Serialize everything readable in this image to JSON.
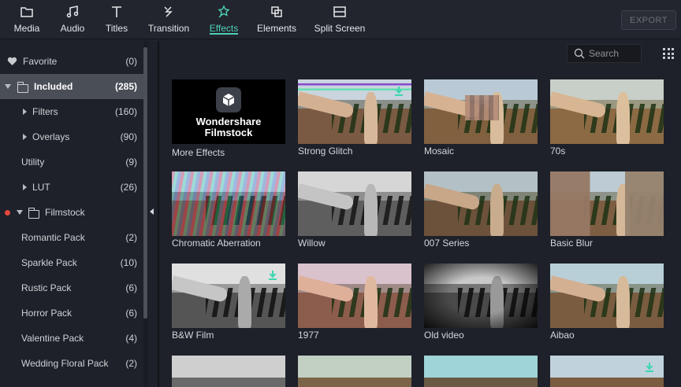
{
  "toolbar": {
    "tabs": [
      {
        "label": "Media",
        "icon": "folder-icon"
      },
      {
        "label": "Audio",
        "icon": "music-note-icon"
      },
      {
        "label": "Titles",
        "icon": "text-icon"
      },
      {
        "label": "Transition",
        "icon": "transition-icon"
      },
      {
        "label": "Effects",
        "icon": "effects-icon",
        "active": true
      },
      {
        "label": "Elements",
        "icon": "elements-icon"
      },
      {
        "label": "Split Screen",
        "icon": "split-screen-icon"
      }
    ],
    "export_label": "EXPORT",
    "accent_color": "#4dd0b8"
  },
  "sidebar": {
    "items": [
      {
        "label": "Favorite",
        "count": "(0)"
      },
      {
        "label": "Included",
        "count": "(285)"
      },
      {
        "label": "Filters",
        "count": "(160)"
      },
      {
        "label": "Overlays",
        "count": "(90)"
      },
      {
        "label": "Utility",
        "count": "(9)"
      },
      {
        "label": "LUT",
        "count": "(26)"
      },
      {
        "label": "Filmstock",
        "count": ""
      },
      {
        "label": "Romantic Pack",
        "count": "(2)"
      },
      {
        "label": "Sparkle Pack",
        "count": "(10)"
      },
      {
        "label": "Rustic Pack",
        "count": "(6)"
      },
      {
        "label": "Horror Pack",
        "count": "(6)"
      },
      {
        "label": "Valentine Pack",
        "count": "(4)"
      },
      {
        "label": "Wedding Floral Pack",
        "count": "(2)"
      }
    ]
  },
  "search": {
    "placeholder": "Search"
  },
  "brand": {
    "line1": "Wondershare",
    "line2": "Filmstock"
  },
  "effects": [
    {
      "name": "More Effects"
    },
    {
      "name": "Strong Glitch"
    },
    {
      "name": "Mosaic"
    },
    {
      "name": "70s"
    },
    {
      "name": "Chromatic Aberration"
    },
    {
      "name": "Willow"
    },
    {
      "name": "007 Series"
    },
    {
      "name": "Basic Blur"
    },
    {
      "name": "B&W Film"
    },
    {
      "name": "1977"
    },
    {
      "name": "Old video"
    },
    {
      "name": "Aibao"
    }
  ]
}
